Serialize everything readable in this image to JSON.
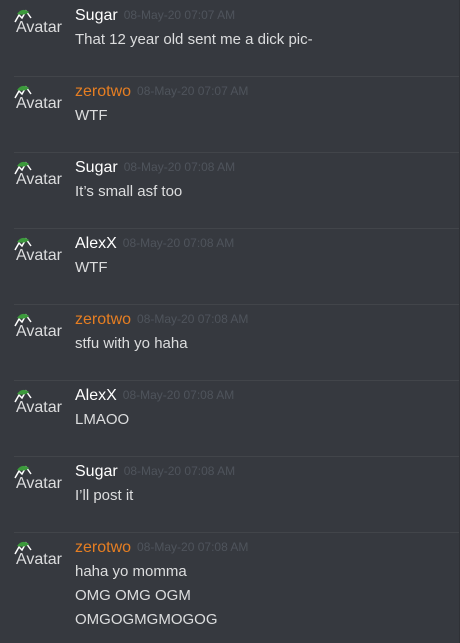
{
  "messages": [
    {
      "author": "Sugar",
      "author_color": "#ffffff",
      "timestamp": "08-May-20 07:07 AM",
      "lines": [
        "That 12 year old sent me a dick pic-"
      ],
      "avatar_alt": "Avatar"
    },
    {
      "author": "zerotwo",
      "author_color": "#e67e22",
      "timestamp": "08-May-20 07:07 AM",
      "lines": [
        "WTF"
      ],
      "avatar_alt": "Avatar"
    },
    {
      "author": "Sugar",
      "author_color": "#ffffff",
      "timestamp": "08-May-20 07:08 AM",
      "lines": [
        "It’s small asf too"
      ],
      "avatar_alt": "Avatar"
    },
    {
      "author": "AlexX",
      "author_color": "#ffffff",
      "timestamp": "08-May-20 07:08 AM",
      "lines": [
        "WTF"
      ],
      "avatar_alt": "Avatar"
    },
    {
      "author": "zerotwo",
      "author_color": "#e67e22",
      "timestamp": "08-May-20 07:08 AM",
      "lines": [
        "stfu with yo haha"
      ],
      "avatar_alt": "Avatar"
    },
    {
      "author": "AlexX",
      "author_color": "#ffffff",
      "timestamp": "08-May-20 07:08 AM",
      "lines": [
        "LMAOO"
      ],
      "avatar_alt": "Avatar"
    },
    {
      "author": "Sugar",
      "author_color": "#ffffff",
      "timestamp": "08-May-20 07:08 AM",
      "lines": [
        "I’ll post it"
      ],
      "avatar_alt": "Avatar"
    },
    {
      "author": "zerotwo",
      "author_color": "#e67e22",
      "timestamp": "08-May-20 07:08 AM",
      "lines": [
        "haha yo momma",
        "OMG OMG OGM",
        "OMGOGMGMOGOG"
      ],
      "avatar_alt": "Avatar"
    }
  ],
  "colors": {
    "background": "#36393f",
    "divider": "#42454a",
    "text": "#dcddde",
    "timestamp": "#4f545c",
    "orange_role": "#e67e22"
  },
  "icons": {
    "avatar": "broken-image-icon"
  }
}
